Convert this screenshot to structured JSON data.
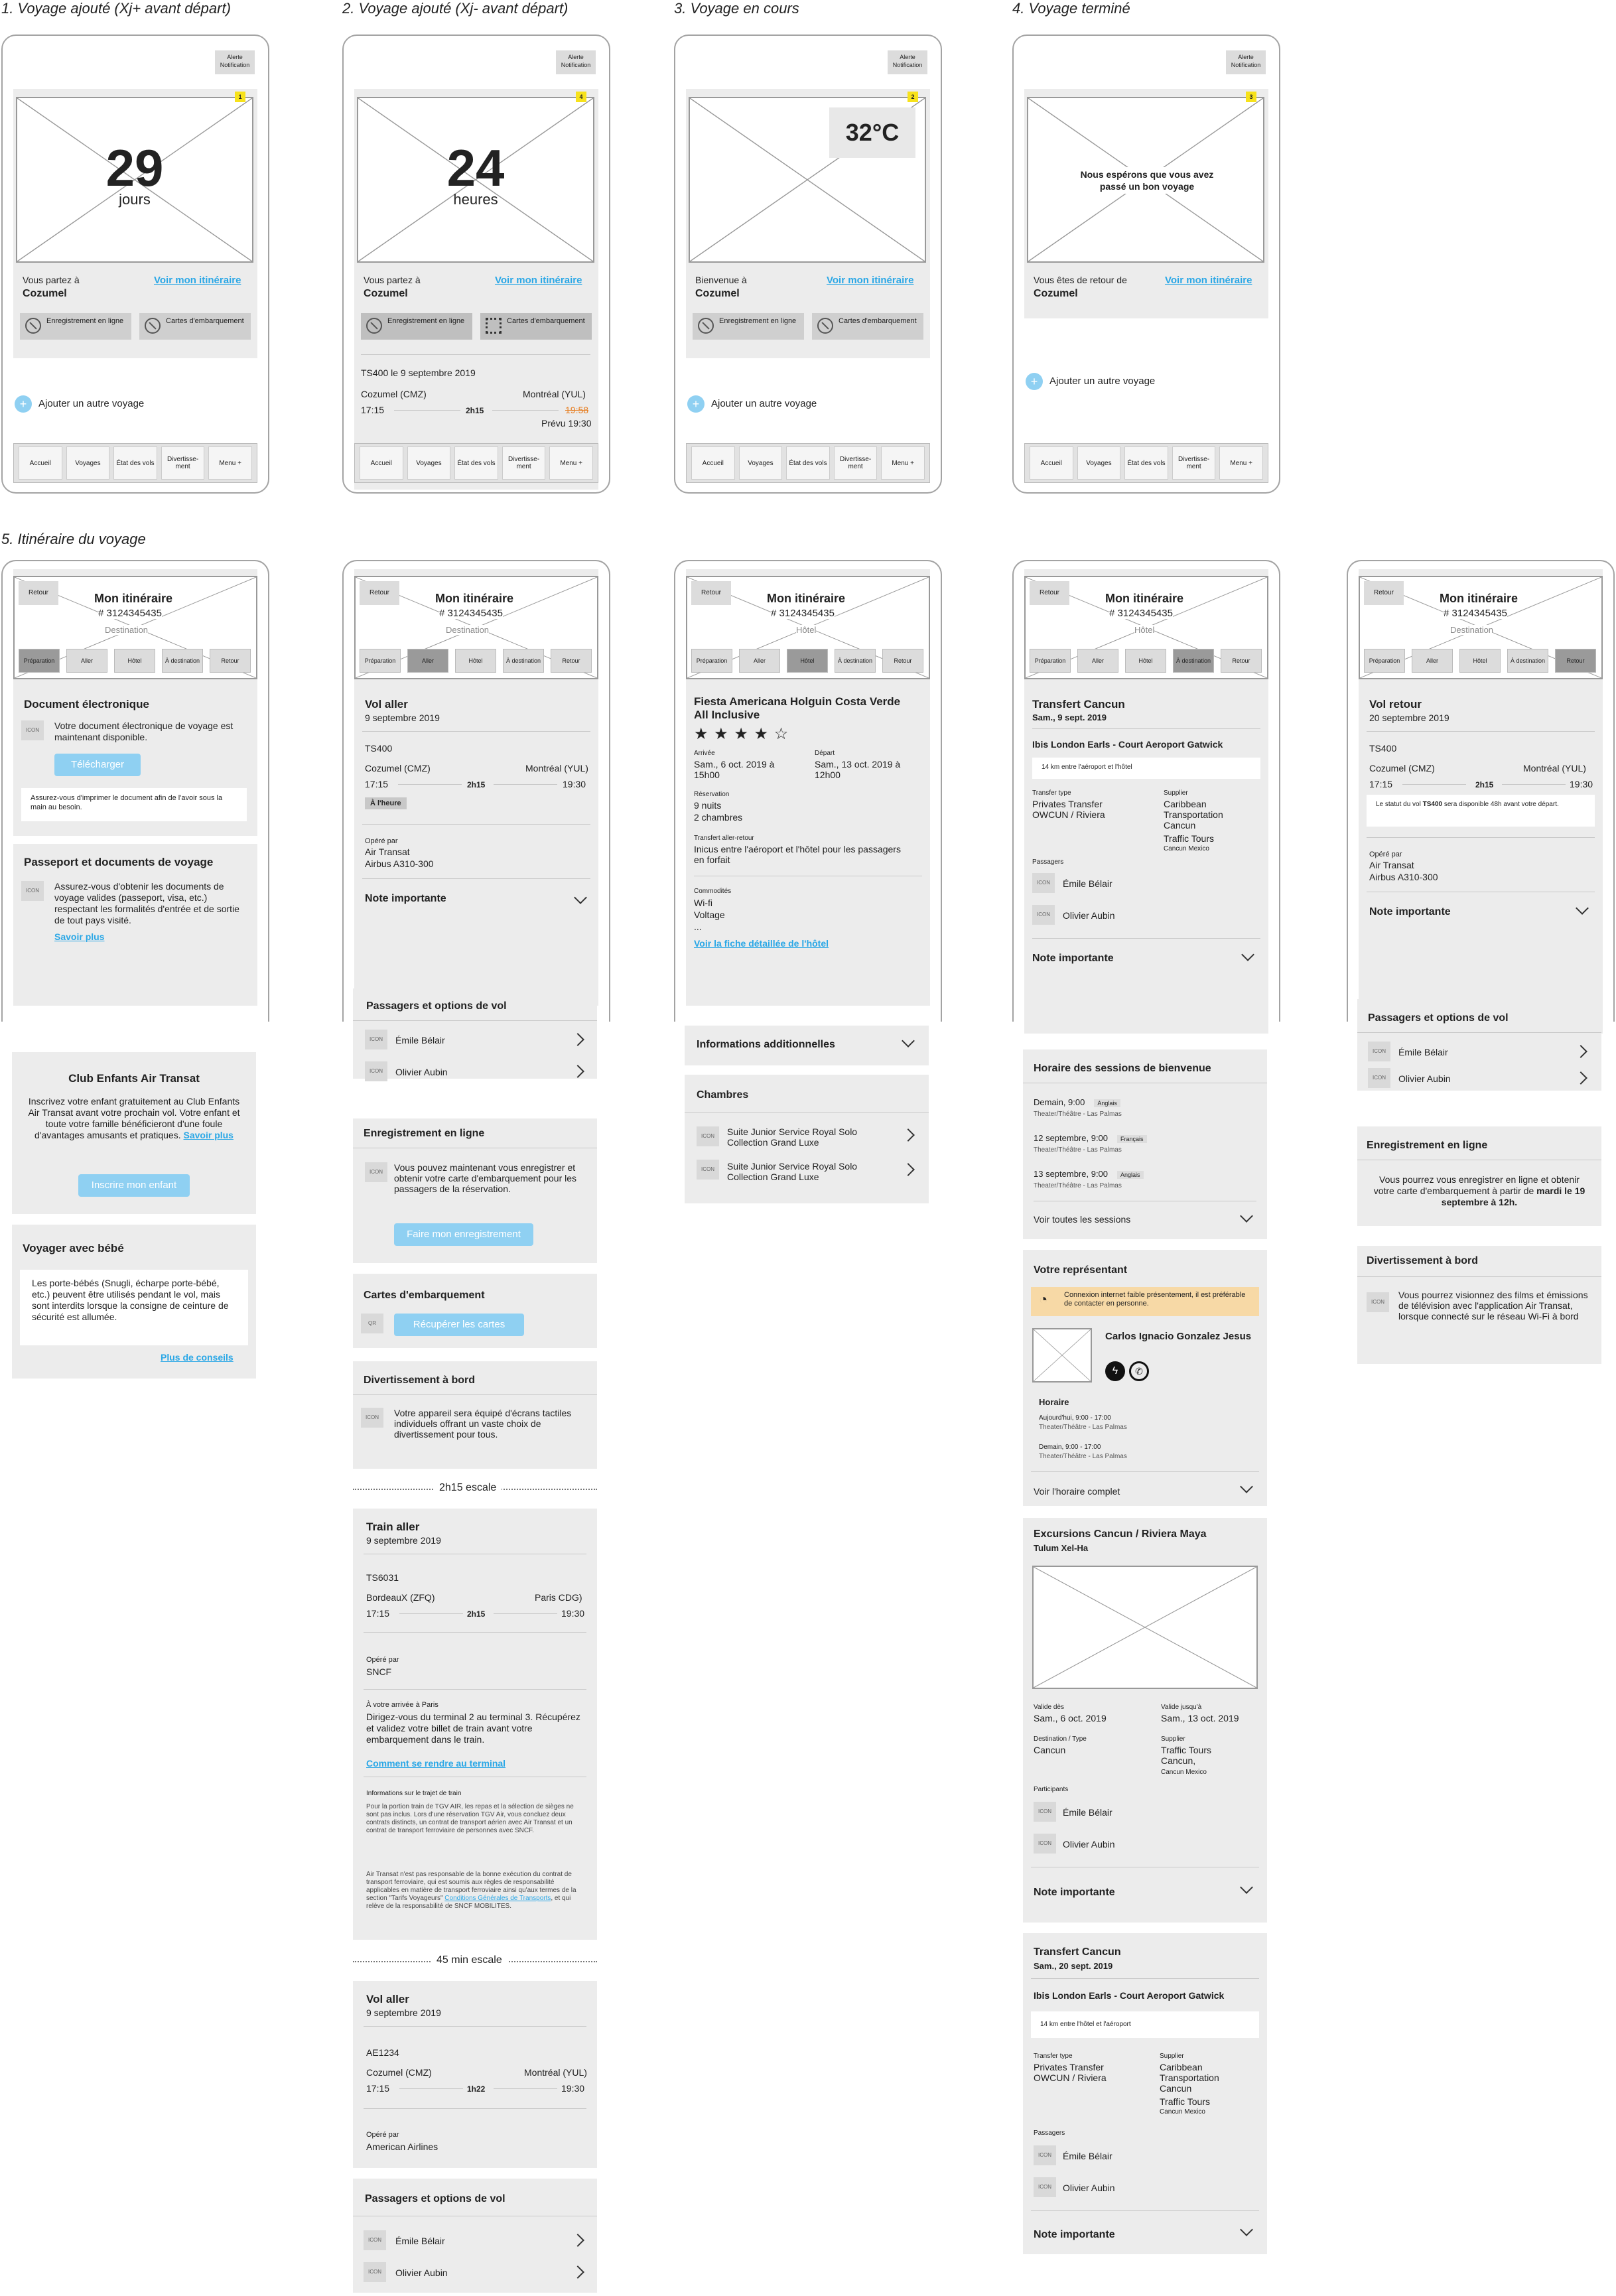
{
  "headings": {
    "h1": "1. Voyage ajouté (Xj+ avant départ)",
    "h2": "2. Voyage ajouté (Xj- avant départ)",
    "h3": "3. Voyage en cours",
    "h4": "4. Voyage terminé",
    "h5": "5. Itinéraire du voyage"
  },
  "common": {
    "alert": "Alerte Notification",
    "voir_itineraire": "Voir mon itinéraire",
    "enregistrement": "Enregistrement en ligne",
    "cartes": "Cartes d'embarquement",
    "ajouter": "Ajouter un autre voyage",
    "nav": [
      "Accueil",
      "Voyages",
      "État des vols",
      "Divertisse-ment",
      "Menu +"
    ],
    "retour": "Retour",
    "mon_itineraire": "Mon itinéraire",
    "booking": "# 3124345435",
    "tabs": [
      "Préparation",
      "Aller",
      "Hôtel",
      "À destination",
      "Retour"
    ],
    "icon": "ICON",
    "emile": "Émile Bélair",
    "olivier": "Olivier Aubin",
    "note": "Note importante",
    "passagers_opts": "Passagers et options de vol",
    "opere_par": "Opéré par"
  },
  "s1": {
    "badge": "1",
    "number": "29",
    "unit": "jours",
    "line1": "Vous partez à",
    "dest": "Cozumel"
  },
  "s2": {
    "badge": "4",
    "number": "24",
    "unit": "heures",
    "line1": "Vous partez à",
    "dest": "Cozumel",
    "flight": "TS400 le 9 septembre 2019",
    "from": "Cozumel (CMZ)",
    "to": "Montréal (YUL)",
    "dep": "17:15",
    "dur": "2h15",
    "arr_old": "19:58",
    "prevu": "Prévu 19:30"
  },
  "s3": {
    "badge": "2",
    "temp": "32°C",
    "line1": "Bienvenue à",
    "dest": "Cozumel"
  },
  "s4": {
    "badge": "3",
    "msg": "Nous espérons que vous avez passé un bon voyage",
    "line1": "Vous êtes de retour de",
    "dest": "Cozumel"
  },
  "col1": {
    "center": "Destination",
    "doc_title": "Document électronique",
    "doc_text": "Votre document électronique de voyage est maintenant disponible.",
    "telecharger": "Télécharger",
    "doc_note": "Assurez-vous d'imprimer le document afin de l'avoir sous la main au besoin.",
    "pass_title": "Passeport et documents de voyage",
    "pass_text": "Assurez-vous d'obtenir les documents de voyage valides (passeport, visa, etc.) respectant les formalités d'entrée et de sortie de tout pays visité.",
    "savoir_plus": "Savoir plus",
    "club_title": "Club Enfants Air Transat",
    "club_text": "Inscrivez votre enfant gratuitement au Club Enfants Air Transat avant votre prochain vol. Votre enfant et toute votre famille bénéficieront d'une foule d'avantages amusants et pratiques.",
    "savoir_plus2": "Savoir plus",
    "inscrire": "Inscrire mon enfant",
    "bebe_title": "Voyager avec bébé",
    "bebe_text": "Les porte-bébés (Snugli, écharpe porte-bébé, etc.) peuvent être utilisés pendant le vol, mais sont interdits lorsque la consigne de ceinture de sécurité est allumée.",
    "conseils": "Plus de conseils"
  },
  "col2": {
    "center": "Destination",
    "vol_title": "Vol aller",
    "vol_date": "9 septembre 2019",
    "flight": "TS400",
    "from": "Cozumel (CMZ)",
    "to": "Montréal (YUL)",
    "dep": "17:15",
    "dur": "2h15",
    "arr": "19:30",
    "status": "À l'heure",
    "op1": "Air Transat",
    "op2": "Airbus A310-300",
    "enreg_title": "Enregistrement en ligne",
    "enreg_text": "Vous pouvez maintenant vous enregistrer et obtenir votre carte d'embarquement pour les passagers de la réservation.",
    "faire": "Faire mon enregistrement",
    "cartes_title": "Cartes d'embarquement",
    "qr": "QR",
    "recuperer": "Récupérer les cartes",
    "divert_title": "Divertissement à bord",
    "divert_text": "Votre appareil sera équipé d'écrans tactiles individuels offrant un vaste choix de divertissement pour tous.",
    "escale1": "2h15 escale",
    "train_title": "Train aller",
    "train_date": "9 septembre 2019",
    "train_no": "TS6031",
    "t_from": "BordeauX (ZFQ)",
    "t_to": "Paris CDG)",
    "t_dep": "17:15",
    "t_dur": "2h15",
    "t_arr": "19:30",
    "t_op": "SNCF",
    "arrivee_label": "À votre arrivée à Paris",
    "arrivee_text": "Dirigez-vous du terminal 2 au terminal 3. Récupérez et validez votre billet de train avant votre embarquement dans le train.",
    "terminal_link": "Comment se rendre au terminal",
    "info_label": "Informations sur le trajet de train",
    "info_p1": "Pour la portion train de TGV AIR, les repas et la sélection de sièges ne sont pas inclus. Lors d'une réservation TGV Air, vous concluez deux contrats distincts, un contrat de transport aérien avec Air Transat et un contrat de transport ferroviaire de personnes avec SNCF.",
    "info_p2a": "Air Transat n'est pas responsable de la bonne exécution du contrat de transport ferroviaire, qui est soumis aux règles de responsabilité applicables en matière de transport ferroviaire ainsi qu'aux termes de la section \"Tarifs Voyageurs\"",
    "info_link": "Conditions Générales de Transports",
    "info_p2b": ", et qui relève de la responsabilité de SNCF MOBILITES.",
    "escale2": "45 min escale",
    "vol2_title": "Vol aller",
    "vol2_date": "9 septembre 2019",
    "vol2_no": "AE1234",
    "v2_from": "Cozumel (CMZ)",
    "v2_to": "Montréal (YUL)",
    "v2_dep": "17:15",
    "v2_dur": "1h22",
    "v2_arr": "19:30",
    "v2_op": "American Airlines"
  },
  "col3": {
    "center": "Hôtel",
    "hotel_title": "Fiesta Americana Holguin Costa Verde All Inclusive",
    "stars": "★ ★ ★ ★ ☆",
    "arrivee_l": "Arrivée",
    "arrivee_v": "Sam., 6 oct. 2019 à 15h00",
    "depart_l": "Départ",
    "depart_v": "Sam., 13 oct. 2019 à 12h00",
    "resa_l": "Réservation",
    "resa_v1": "9 nuits",
    "resa_v2": "2 chambres",
    "transfert_l": "Transfert aller-retour",
    "transfert_v": "Inicus entre l'aéroport et l'hôtel pour les passagers en forfait",
    "comm_l": "Commodités",
    "comm_v": "Wi-fi\nVoltage\n...",
    "fiche": "Voir la fiche détaillée de l'hôtel",
    "info_add": "Informations additionnelles",
    "chambres": "Chambres",
    "room1": "Suite Junior Service Royal Solo Collection Grand Luxe",
    "room2": "Suite Junior Service Royal Solo Collection Grand Luxe"
  },
  "col4": {
    "center": "Hôtel",
    "tr_title": "Transfert Cancun",
    "tr_date": "Sam., 9 sept. 2019",
    "tr_hotel": "Ibis London Earls - Court Aeroport Gatwick",
    "tr_dist": "14 km entre l'aéroport et l'hôtel",
    "type_l": "Transfer type",
    "type_v": "Privates Transfer OWCUN / Riviera",
    "supp_l": "Supplier",
    "supp_v": "Caribbean Transportation Cancun",
    "supp_v2": "Traffic Tours",
    "supp_v3": "Cancun Mexico",
    "pass_l": "Passagers",
    "horaire_title": "Horaire des sessions de bienvenue",
    "sess1": "Demain, 9:00",
    "sess1_lang": "Anglais",
    "sess2": "12 septembre, 9:00",
    "sess2_lang": "Français",
    "sess3": "13 septembre, 9:00",
    "sess3_lang": "Anglais",
    "sess_place": "Theater/Théâtre - Las Palmas",
    "all_sessions": "Voir toutes les sessions",
    "rep_title": "Votre représentant",
    "rep_warn": "Connexion internet faible présentement, il est préférable de contacter en personne.",
    "rep_name": "Carlos Ignacio Gonzalez Jesus",
    "horaire_l": "Horaire",
    "h1": "Aujourd'hui, 9:00 - 17:00",
    "h2": "Demain, 9:00 - 17:00",
    "full_sched": "Voir l'horaire complet",
    "exc_title": "Excursions Cancun / Riviera Maya",
    "exc_sub": "Tulum Xel-Ha",
    "valide_l": "Valide dès",
    "valide_v": "Sam., 6 oct. 2019",
    "jusqua_l": "Valide jusqu'à",
    "jusqua_v": "Sam., 13 oct. 2019",
    "dest_l": "Destination / Type",
    "dest_v": "Cancun",
    "sup2_l": "Supplier",
    "sup2_v": "Traffic Tours Cancun,",
    "sup2_v2": "Cancun Mexico",
    "part_l": "Participants",
    "tr2_title": "Transfert Cancun",
    "tr2_date": "Sam., 20 sept. 2019",
    "tr2_dist": "14 km entre l'hôtel et l'aéroport"
  },
  "col5": {
    "center": "Destination",
    "vol_title": "Vol retour",
    "vol_date": "20 septembre 2019",
    "flight": "TS400",
    "from": "Cozumel (CMZ)",
    "to": "Montréal (YUL)",
    "dep": "17:15",
    "dur": "2h15",
    "arr": "19:30",
    "status_a": "Le statut du vol ",
    "status_b": "TS400",
    "status_c": " sera disponible 48h avant votre départ.",
    "op1": "Air Transat",
    "op2": "Airbus A310-300",
    "enreg_title": "Enregistrement en ligne",
    "enreg_text_a": "Vous pourrez vous enregistrer en ligne et obtenir votre carte d'embarquement à partir de ",
    "enreg_text_b": "mardi le 19 septembre à 12h.",
    "divert_title": "Divertissement à bord",
    "divert_text": "Vous pourrez visionnez des films et émissions de télévision avec l'application Air Transat, lorsque connecté sur le réseau Wi-Fi à bord"
  }
}
